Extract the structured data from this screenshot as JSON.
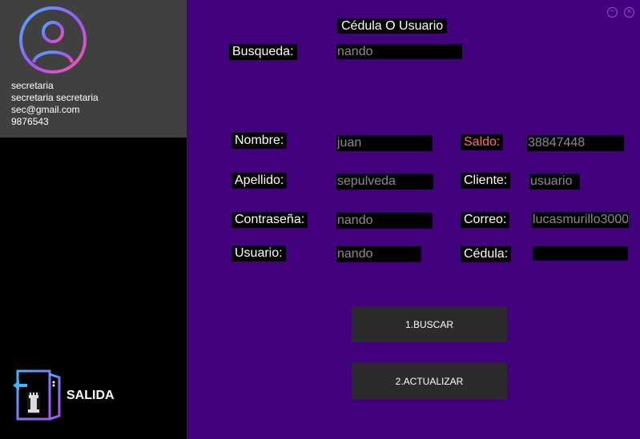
{
  "sidebar": {
    "user": {
      "role": "secretaria",
      "full_name": "secretaria secretaria",
      "email": "sec@gmail.com",
      "phone": "9876543"
    },
    "exit_label": "SALIDA"
  },
  "main": {
    "search_title": "Cédula O Usuario",
    "search_label": "Busqueda:",
    "search_value": "nando",
    "fields": {
      "nombre": {
        "label": "Nombre:",
        "value": "juan"
      },
      "apellido": {
        "label": "Apellido:",
        "value": "sepulveda"
      },
      "contrasena": {
        "label": "Contraseña:",
        "value": "nando"
      },
      "usuario": {
        "label": "Usuario:",
        "value": "nando"
      },
      "saldo": {
        "label": "Saldo:",
        "value": "38847448"
      },
      "cliente": {
        "label": "Cliente:",
        "value": "usuario"
      },
      "correo": {
        "label": "Correo:",
        "value": "lucasmurillo3000"
      },
      "cedula": {
        "label": "Cédula:",
        "value": ""
      }
    },
    "buttons": {
      "buscar": "1.BUSCAR",
      "actualizar": "2.ACTUALIZAR"
    },
    "window_controls": {
      "minimize": "−",
      "close": "×"
    }
  },
  "colors": {
    "main_bg": "#43027d",
    "profile_bg": "#404040",
    "saldo_label": "#ff6b6b",
    "button_bg": "#2b2b2b"
  },
  "icons": [
    "user-avatar-icon",
    "exit-door-icon",
    "minimize-icon",
    "close-icon"
  ]
}
